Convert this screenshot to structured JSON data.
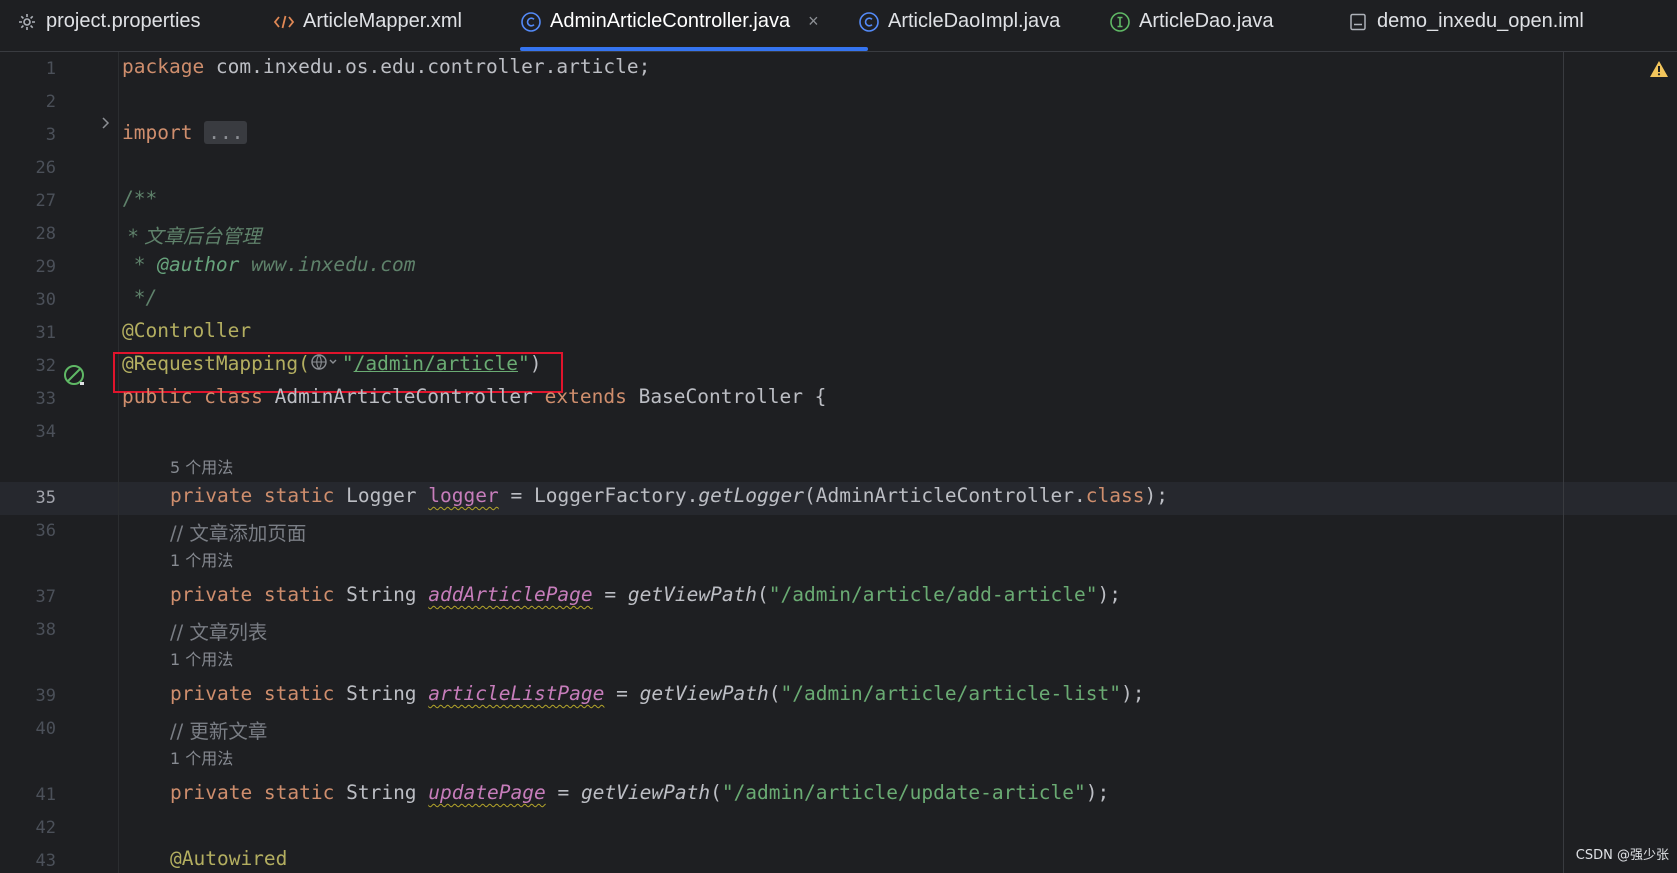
{
  "tabs": [
    {
      "label": "project.properties",
      "icon": "gear-icon"
    },
    {
      "label": "ArticleMapper.xml",
      "icon": "xml-tag-icon"
    },
    {
      "label": "AdminArticleController.java",
      "icon": "java-class-icon",
      "active": true
    },
    {
      "label": "ArticleDaoImpl.java",
      "icon": "java-class-icon"
    },
    {
      "label": "ArticleDao.java",
      "icon": "java-interface-icon"
    },
    {
      "label": "demo_inxedu_open.iml",
      "icon": "module-file-icon"
    }
  ],
  "tab_close": "×",
  "line_numbers": [
    "1",
    "2",
    "3",
    "26",
    "27",
    "28",
    "29",
    "30",
    "31",
    "32",
    "33",
    "34",
    "35",
    "36",
    "37",
    "38",
    "39",
    "40",
    "41",
    "42",
    "43"
  ],
  "code": {
    "l1_kw": "package",
    "l1_rest": " com.inxedu.os.edu.controller.article;",
    "l3_kw": "import",
    "l3_fold": "...",
    "l27": "/**",
    "l28": " * 文章后台管理",
    "l29_star": " * ",
    "l29_tag": "@author",
    "l29_val": " www.inxedu.com",
    "l30": " */",
    "l31": "@Controller",
    "l32_ann": "@RequestMapping(",
    "l32_q1": "\"",
    "l32_url": "/admin/article",
    "l32_q2": "\"",
    "l32_close": ")",
    "l33_kw1": "public class ",
    "l33_name": "AdminArticleController ",
    "l33_kw2": "extends ",
    "l33_rest": "BaseController {",
    "hint_35": "5 个用法",
    "l35_kw": "private static ",
    "l35_type": "Logger ",
    "l35_field": "logger",
    "l35_eq": " = LoggerFactory.",
    "l35_call": "getLogger",
    "l35_arg": "(AdminArticleController.",
    "l35_class": "class",
    "l35_end": ");",
    "l36": "// 文章添加页面",
    "hint_37": "1 个用法",
    "l37_kw": "private static ",
    "l37_type": "String ",
    "l37_field": "addArticlePage",
    "l37_eq": " = ",
    "l37_call": "getViewPath",
    "l37_str": "\"/admin/article/add-article\"",
    "l37_end": ");",
    "l38": "// 文章列表",
    "hint_39": "1 个用法",
    "l39_kw": "private static ",
    "l39_type": "String ",
    "l39_field": "articleListPage",
    "l39_eq": " = ",
    "l39_call": "getViewPath",
    "l39_str": "\"/admin/article/article-list\"",
    "l39_end": ");",
    "l40": "// 更新文章",
    "hint_41": "1 个用法",
    "l41_kw": "private static ",
    "l41_type": "String ",
    "l41_field": "updatePage",
    "l41_eq": " = ",
    "l41_call": "getViewPath",
    "l41_str": "\"/admin/article/update-article\"",
    "l41_end": ");",
    "l43": "@Autowired"
  },
  "watermark": "CSDN @强少张",
  "colors": {
    "accent": "#3574f0",
    "highlight_box": "#e0142c",
    "keyword": "#cf8e6d",
    "string": "#6aab73",
    "annotation": "#b3ae60"
  }
}
